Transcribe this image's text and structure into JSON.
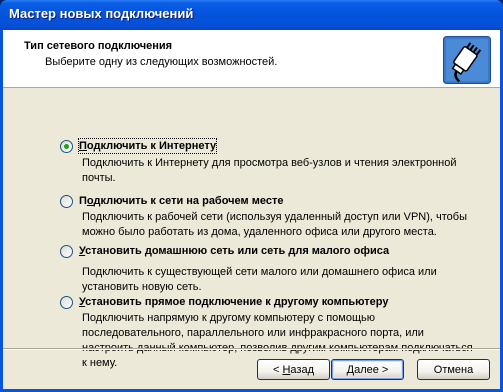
{
  "window": {
    "title": "Мастер новых подключений"
  },
  "header": {
    "title": "Тип сетевого подключения",
    "subtitle": "Выберите одну из следующих возможностей."
  },
  "options": [
    {
      "mnemonic": "П",
      "label_rest": "одключить к Интернету",
      "description": "Подключить к Интернету для просмотра веб-узлов и чтения  электронной почты.",
      "selected": true
    },
    {
      "pre": "П",
      "mnemonic": "о",
      "label_rest": "дключить к сети на рабочем месте",
      "description": "Подключить к рабочей сети (используя удаленный доступ или VPN), чтобы можно было работать из дома, удаленного офиса или другого места.",
      "selected": false
    },
    {
      "mnemonic": "У",
      "label_rest": "становить домашнюю сеть или сеть для малого офиса",
      "description": "Подключить к существующей сети малого или домашнего офиса или установить новую сеть.",
      "selected": false
    },
    {
      "mnemonic": "У",
      "label_rest": "становить прямое подключение к другому компьютеру",
      "description": "Подключить напрямую к другому компьютеру с помощью последовательного, параллельного или инфракрасного порта, или настроить данный компьютер, позволив другим  компьютерам подключаться к нему.",
      "selected": false
    }
  ],
  "buttons": {
    "back": {
      "prefix": "< ",
      "mnemonic": "Н",
      "rest": "азад"
    },
    "next": {
      "mnemonic": "Д",
      "rest": "алее >"
    },
    "cancel": {
      "label": "Отмена"
    }
  }
}
